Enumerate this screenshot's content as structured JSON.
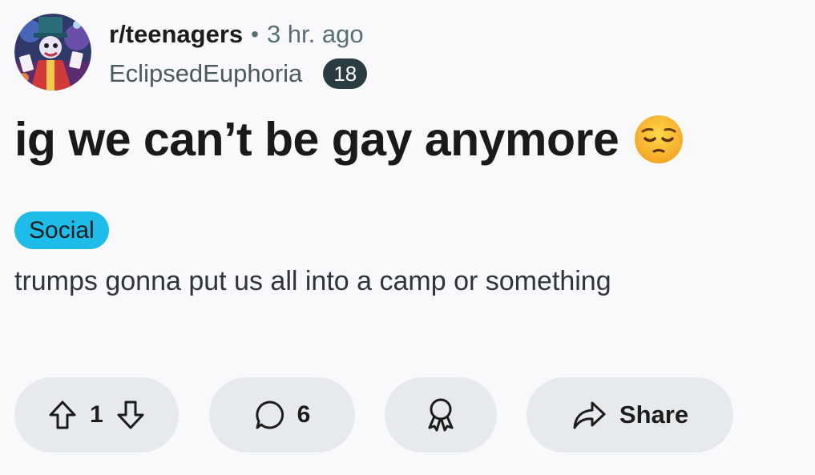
{
  "header": {
    "subreddit": "r/teenagers",
    "separator": "•",
    "time_ago": "3 hr. ago",
    "author": "EclipsedEuphoria",
    "age_badge": "18",
    "avatar_icon": "avatar-image"
  },
  "post": {
    "title": "ig we can’t be gay anymore",
    "title_emoji": "pensive-face-emoji",
    "flair": "Social",
    "flair_color": "#1ebce8",
    "body": "trumps gonna put us all into a camp or something"
  },
  "actions": {
    "upvote_icon": "upvote-arrow-icon",
    "vote_count": "1",
    "downvote_icon": "downvote-arrow-icon",
    "comment_icon": "comment-bubble-icon",
    "comment_count": "6",
    "award_icon": "award-ribbon-icon",
    "share_icon": "share-arrow-icon",
    "share_label": "Share"
  },
  "colors": {
    "background": "#f9f9fb",
    "pill_background": "#e6eaed",
    "badge_background": "#2a3c42",
    "muted_text": "#576f76"
  }
}
